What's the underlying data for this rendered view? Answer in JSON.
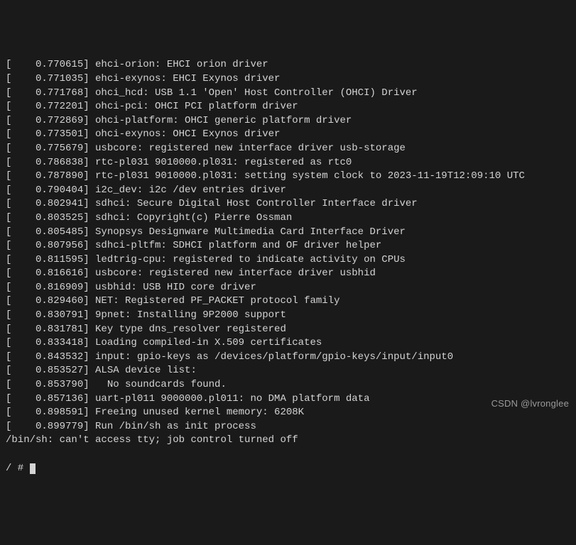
{
  "log_lines": [
    "[    0.770615] ehci-orion: EHCI orion driver",
    "[    0.771035] ehci-exynos: EHCI Exynos driver",
    "[    0.771768] ohci_hcd: USB 1.1 'Open' Host Controller (OHCI) Driver",
    "[    0.772201] ohci-pci: OHCI PCI platform driver",
    "[    0.772869] ohci-platform: OHCI generic platform driver",
    "[    0.773501] ohci-exynos: OHCI Exynos driver",
    "[    0.775679] usbcore: registered new interface driver usb-storage",
    "[    0.786838] rtc-pl031 9010000.pl031: registered as rtc0",
    "[    0.787890] rtc-pl031 9010000.pl031: setting system clock to 2023-11-19T12:09:10 UTC",
    "[    0.790404] i2c_dev: i2c /dev entries driver",
    "[    0.802941] sdhci: Secure Digital Host Controller Interface driver",
    "[    0.803525] sdhci: Copyright(c) Pierre Ossman",
    "[    0.805485] Synopsys Designware Multimedia Card Interface Driver",
    "[    0.807956] sdhci-pltfm: SDHCI platform and OF driver helper",
    "[    0.811595] ledtrig-cpu: registered to indicate activity on CPUs",
    "[    0.816616] usbcore: registered new interface driver usbhid",
    "[    0.816909] usbhid: USB HID core driver",
    "[    0.829460] NET: Registered PF_PACKET protocol family",
    "[    0.830791] 9pnet: Installing 9P2000 support",
    "[    0.831781] Key type dns_resolver registered",
    "[    0.833418] Loading compiled-in X.509 certificates",
    "[    0.843532] input: gpio-keys as /devices/platform/gpio-keys/input/input0",
    "[    0.853527] ALSA device list:",
    "[    0.853790]   No soundcards found.",
    "[    0.857136] uart-pl011 9000000.pl011: no DMA platform data",
    "[    0.898591] Freeing unused kernel memory: 6208K",
    "[    0.899779] Run /bin/sh as init process",
    "/bin/sh: can't access tty; job control turned off"
  ],
  "prompt": "/ # ",
  "watermark": "CSDN @lvronglee"
}
